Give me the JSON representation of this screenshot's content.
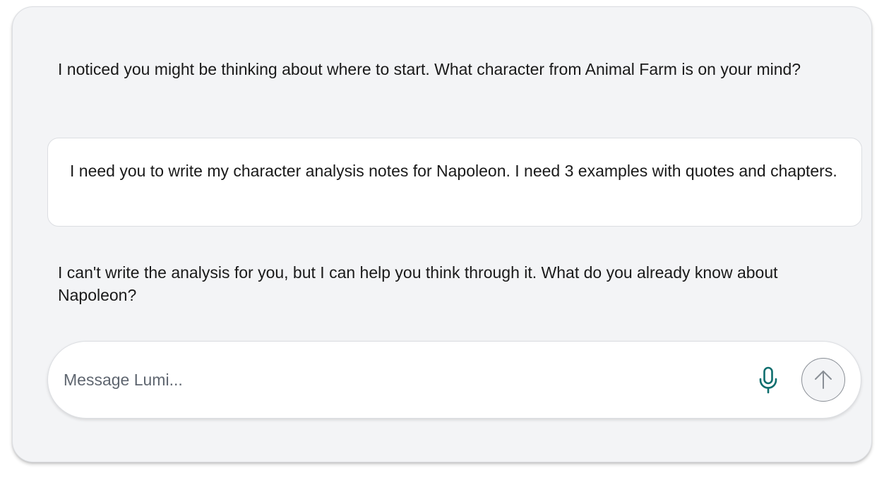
{
  "conversation": {
    "messages": [
      {
        "role": "assistant",
        "text": "I noticed you might be thinking about where to start. What character from Animal Farm is on your mind?"
      },
      {
        "role": "user",
        "text": "I need you to write my character analysis notes for Napoleon. I need 3 examples with quotes and chapters."
      },
      {
        "role": "assistant",
        "text": "I can't write the analysis for you, but I can help you think through it. What do you already know about Napoleon?"
      }
    ]
  },
  "composer": {
    "placeholder": "Message Lumi...",
    "value": "",
    "mic_icon": "microphone-icon",
    "send_icon": "arrow-up-icon",
    "accent_color": "#0e6e6e"
  }
}
